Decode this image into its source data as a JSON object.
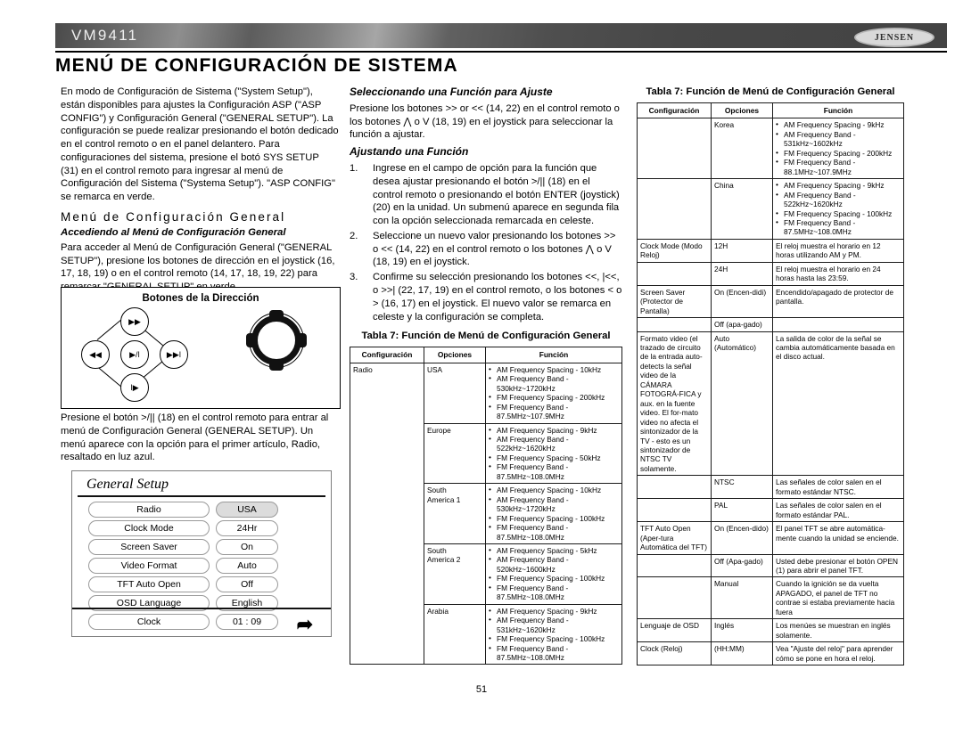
{
  "header": {
    "model": "VM9411",
    "brand": "JENSEN"
  },
  "page_title": "MENÚ DE CONFIGURACIÓN DE SISTEMA",
  "page_number": "51",
  "col1": {
    "intro": "En modo de Configuración de Sistema (\"System Setup\"), están disponibles para ajustes la Configuración ASP (\"ASP CONFIG\") y Configuración General (\"GENERAL SETUP\"). La configuración se puede realizar presionando el botón dedicado en el control remoto o en el panel delantero. Para configuraciones del sistema, presione el botó SYS SETUP (31) en el control remoto para ingresar al menú de Configuración del Sistema (\"Systema Setup\"). \"ASP CONFIG\" se remarca en verde.",
    "heading": "Menú de Configuración General",
    "subheading": "Accediendo al Menú de Configuración General",
    "access_text": "Para acceder al Menú de Configuración General (\"GENERAL SETUP\"), presione los botones de dirección en el joystick (16, 17, 18, 19) o en el control remoto (14, 17, 18, 19, 22) para remarcar \"GENERAL SETUP\" en verde.",
    "figure_title": "Botones de la Dirección",
    "dpad": {
      "up": "▶▶",
      "left": "◀◀",
      "center": "▶/ǀ",
      "right": "▶▶ǀ",
      "down": "ǀ▶"
    },
    "osd_intro": "Presione el botón >/|| (18) en el control remoto para entrar al menú de Configuración General (GENERAL SETUP). Un menú aparece con la opción para el primer artículo, Radio, resaltado en luz azul.",
    "osd": {
      "title": "General Setup",
      "rows": [
        {
          "label": "Radio",
          "value": "USA",
          "selected": true
        },
        {
          "label": "Clock  Mode",
          "value": "24Hr",
          "selected": false
        },
        {
          "label": "Screen Saver",
          "value": "On",
          "selected": false
        },
        {
          "label": "Video Format",
          "value": "Auto",
          "selected": false
        },
        {
          "label": "TFT Auto Open",
          "value": "Off",
          "selected": false
        },
        {
          "label": "OSD Language",
          "value": "English",
          "selected": false
        },
        {
          "label": "Clock",
          "value": "01 :  09",
          "selected": false
        }
      ],
      "back_icon": "back-arrow-icon"
    }
  },
  "col2": {
    "h_select": "Seleccionando una Función para Ajuste",
    "p_select": "Presione los botones >> or << (14, 22) en el control remoto o los botones ⋀ o V (18, 19) en el joystick para seleccionar la función a ajustar.",
    "h_adjust": "Ajustando una Función",
    "steps": [
      {
        "num": "1.",
        "text": "Ingrese en el campo de opción para la función que desea ajustar presionando el botón >/|| (18) en el control remoto o presionando el botón ENTER (joystick) (20) en la unidad. Un submenú aparece en segunda fila con la opción seleccionada remarcada en celeste."
      },
      {
        "num": "2.",
        "text": "Seleccione un nuevo valor presionando los botones >> o << (14, 22) en el control remoto o los botones ⋀ o V (18, 19) en el joystick."
      },
      {
        "num": "3.",
        "text": "Confirme su selección presionando los botones <<, |<<, o >>| (22, 17, 19) en el control remoto, o los botones < o > (16, 17) en el joystick. El nuevo valor se remarca en celeste y la configuración se completa."
      }
    ],
    "table_caption": "Tabla 7: Función de Menú de Configuración General",
    "table_headers": [
      "Configuración",
      "Opciones",
      "Función"
    ],
    "rows": [
      {
        "cfg": "Radio",
        "rowspan": 5,
        "opt": "USA",
        "fn": [
          "AM Frequency Spacing - 10kHz",
          "AM Frequency Band -|530kHz~1720kHz",
          "FM Frequency Spacing - 200kHz",
          "FM Frequency Band -|87.5MHz~107.9MHz"
        ]
      },
      {
        "cfg": "",
        "opt": "Europe",
        "fn": [
          "AM Frequency Spacing - 9kHz",
          "AM Frequency Band -|522kHz~1620kHz",
          "FM Frequency Spacing - 50kHz",
          "FM Frequency Band -|87.5MHz~108.0MHz"
        ]
      },
      {
        "cfg": "",
        "opt": "South|America 1",
        "fn": [
          "AM Frequency Spacing - 10kHz",
          "AM Frequency Band -|530kHz~1720kHz",
          "FM Frequency Spacing - 100kHz",
          "FM Frequency Band -|87.5MHz~108.0MHz"
        ]
      },
      {
        "cfg": "",
        "opt": "South|America 2",
        "fn": [
          "AM Frequency Spacing - 5kHz",
          "AM Frequency Band -|520kHz~1600kHz",
          "FM Frequency Spacing - 100kHz",
          "FM Frequency Band -|87.5MHz~108.0MHz"
        ]
      },
      {
        "cfg": "",
        "opt": "Arabia",
        "fn": [
          "AM Frequency Spacing - 9kHz",
          "AM Frequency Band -|531kHz~1620kHz",
          "FM Frequency Spacing - 100kHz",
          "FM Frequency Band -|87.5MHz~108.0MHz"
        ]
      }
    ]
  },
  "col3": {
    "table_caption": "Tabla 7: Función de Menú de Configuración General",
    "table_headers": [
      "Configuración",
      "Opciones",
      "Función"
    ],
    "rows": [
      {
        "cfg": "",
        "opt": "Korea",
        "fn": [
          "AM Frequency Spacing - 9kHz",
          "AM Frequency Band -|531kHz~1602kHz",
          "FM Frequency Spacing - 200kHz",
          "FM Frequency Band -|88.1MHz~107.9MHz"
        ]
      },
      {
        "cfg": "",
        "opt": "China",
        "fn": [
          "AM Frequency Spacing - 9kHz",
          "AM Frequency Band -|522kHz~1620kHz",
          "FM Frequency Spacing - 100kHz",
          "FM Frequency Band -|87.5MHz~108.0MHz"
        ]
      },
      {
        "cfg": "Clock Mode (Modo Reloj)",
        "opt": "12H",
        "text": "El reloj muestra el horario en 12 horas utilizando AM y PM."
      },
      {
        "cfg": "",
        "opt": "24H",
        "text": "El reloj muestra el horario en 24 horas hasta las 23:59."
      },
      {
        "cfg": "Screen Saver (Protector de Pantalla)",
        "opt": "On (Encen-didi)",
        "text": "Encendido/apagado de protector de pantalla."
      },
      {
        "cfg": "",
        "opt": "Off (apa-gado)",
        "text": ""
      },
      {
        "cfg": "Formato video (el trazado de circuito de la entrada auto-detects la señal video de la CÁMARA FOTOGRÁ-FICA y aux. en la fuente video. El for-mato video no afecta el sintonizador de la TV - esto es un sintonizador de NTSC TV solamente.",
        "opt": "Auto (Automático)",
        "text": "La salida de color de la señal se cambia automáticamente basada en el disco actual."
      },
      {
        "cfg": "",
        "opt": "NTSC",
        "text": "Las señales de color salen en el formato estándar NTSC."
      },
      {
        "cfg": "",
        "opt": "PAL",
        "text": "Las señales de color salen en el formato estándar PAL."
      },
      {
        "cfg": "TFT Auto Open (Aper-tura Automática del TFT)",
        "opt": "On (Encen-dido)",
        "text": "El panel TFT se abre automática-mente cuando la unidad se enciende."
      },
      {
        "cfg": "",
        "opt": "Off (Apa-gado)",
        "text": "Usted debe presionar el botón OPEN (1) para abrir el panel TFT."
      },
      {
        "cfg": "",
        "opt": "Manual",
        "text": "Cuando la ignición se da vuelta APAGADO, el panel de TFT no contrae si estaba previamente hacia fuera"
      },
      {
        "cfg": "Lenguaje de OSD",
        "opt": "Inglés",
        "text": "Los menúes se muestran en inglés solamente."
      },
      {
        "cfg": "Clock (Reloj)",
        "opt": "(HH:MM)",
        "text": "Vea \"Ajuste del reloj\" para aprender cómo se pone en hora el reloj."
      }
    ]
  }
}
